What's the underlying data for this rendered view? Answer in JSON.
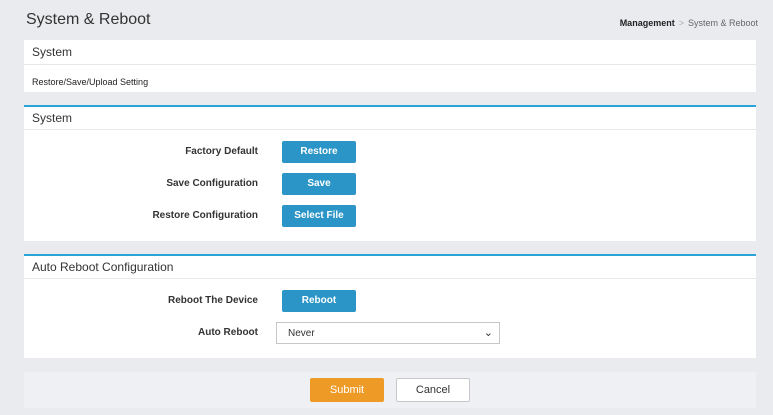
{
  "header": {
    "title": "System & Reboot",
    "breadcrumb": {
      "parent": "Management",
      "separator": ">",
      "current": "System & Reboot"
    }
  },
  "info_panel": {
    "title": "System",
    "description": "Restore/Save/Upload Setting"
  },
  "system_panel": {
    "title": "System",
    "rows": [
      {
        "label": "Factory Default",
        "button": "Restore"
      },
      {
        "label": "Save Configuration",
        "button": "Save"
      },
      {
        "label": "Restore Configuration",
        "button": "Select File"
      }
    ]
  },
  "reboot_panel": {
    "title": "Auto Reboot Configuration",
    "reboot_label": "Reboot The Device",
    "reboot_button": "Reboot",
    "auto_label": "Auto Reboot",
    "auto_value": "Never"
  },
  "footer": {
    "submit": "Submit",
    "cancel": "Cancel"
  },
  "colors": {
    "accent": "#2aa3d8",
    "button": "#2a95c6",
    "submit": "#ee9a26"
  }
}
